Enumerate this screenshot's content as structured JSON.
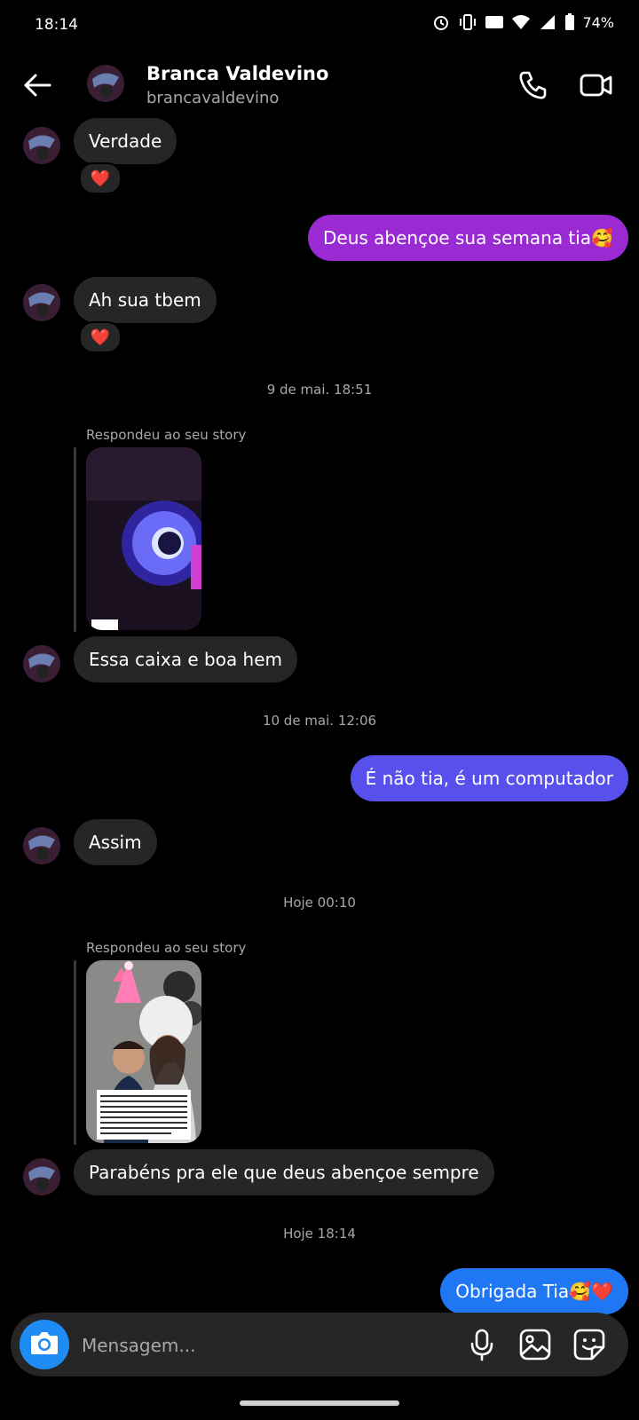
{
  "status": {
    "time": "18:14",
    "battery": "74%"
  },
  "header": {
    "name": "Branca Valdevino",
    "handle": "brancavaldevino"
  },
  "messages": {
    "m1": "Verdade",
    "m2": "Deus abençoe sua semana tia🥰",
    "m3": "Ah sua tbem",
    "ts1": "9 de mai. 18:51",
    "reply1": "Respondeu ao seu story",
    "m4": "Essa caixa e boa hem",
    "ts2": "10 de mai. 12:06",
    "m5": "É não tia, é um computador",
    "m6": "Assim",
    "ts3": "Hoje 00:10",
    "reply2": "Respondeu ao seu story",
    "m7": "Parabéns pra ele que deus abençoe sempre",
    "ts4": "Hoje 18:14",
    "m8": "Obrigada Tia🥰❤️"
  },
  "reactions": {
    "heart": "❤️"
  },
  "composer": {
    "placeholder": "Mensagem..."
  },
  "colors": {
    "sent_purple": "#9a2bd3",
    "sent_indigo": "#5850ec",
    "sent_blue": "#1f77f4",
    "received": "#262626",
    "camera_button": "#1f8cf6"
  },
  "icons": [
    "back-arrow-icon",
    "phone-icon",
    "video-icon",
    "camera-icon",
    "microphone-icon",
    "gallery-icon",
    "sticker-icon",
    "alarm-icon",
    "vibrate-icon",
    "volte-icon",
    "wifi-icon",
    "signal-icon",
    "battery-icon"
  ]
}
